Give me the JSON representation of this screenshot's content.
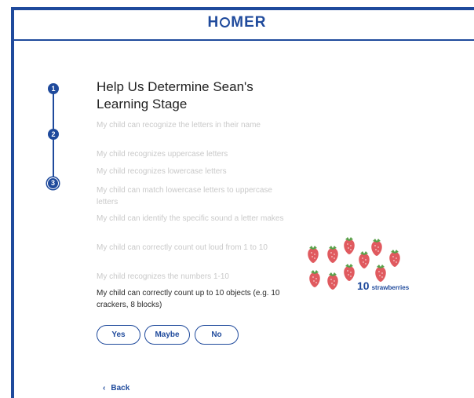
{
  "header": {
    "logo_text": [
      "H",
      "MER"
    ]
  },
  "stepper": {
    "steps": [
      "1",
      "2",
      "3"
    ]
  },
  "main": {
    "title": "Help Us Determine Sean's Learning Stage",
    "questions": [
      "My child can recognize the letters in their name",
      "My child recognizes uppercase letters",
      "My child recognizes lowercase letters",
      "My child can match lowercase letters to uppercase letters",
      "My child can identify the specific sound a letter makes",
      "My child can correctly count out loud from 1 to 10",
      "My child recognizes the numbers 1-10",
      "My child can correctly count up to 10 objects (e.g. 10 crackers, 8 blocks)"
    ],
    "answers": {
      "yes": "Yes",
      "maybe": "Maybe",
      "no": "No"
    },
    "back_label": "Back"
  },
  "illustration": {
    "count": "10",
    "label": "strawberries",
    "icon": "strawberry-icon"
  },
  "colors": {
    "brand": "#1f4a9c",
    "muted_text": "#c9c9c9",
    "strawberry": "#e05a5f"
  }
}
